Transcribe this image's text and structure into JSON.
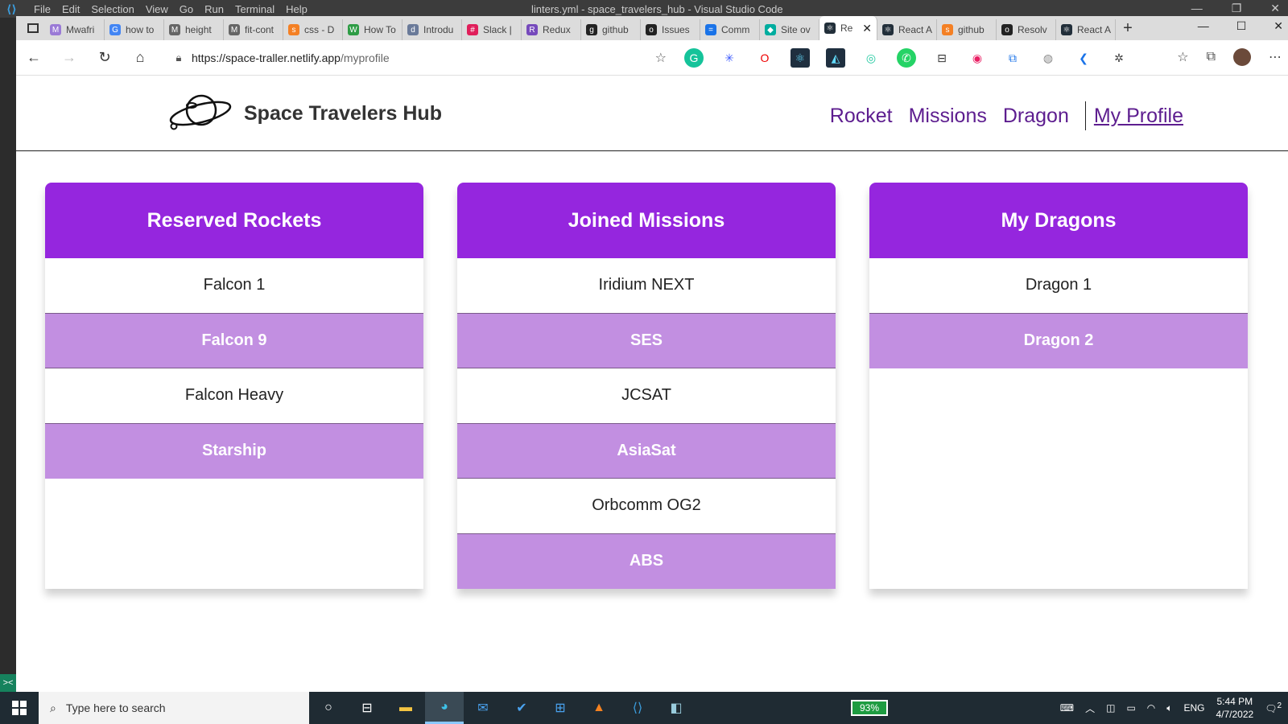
{
  "vscode": {
    "menu": [
      "File",
      "Edit",
      "Selection",
      "View",
      "Go",
      "Run",
      "Terminal",
      "Help"
    ],
    "title": "linters.yml - space_travelers_hub - Visual Studio Code",
    "remote": "><"
  },
  "browser": {
    "tabs": [
      {
        "label": "Mwafri",
        "color": "#9a7ad6",
        "icon": "M"
      },
      {
        "label": "how to",
        "color": "#4285f4",
        "icon": "G"
      },
      {
        "label": "height",
        "color": "#666666",
        "icon": "M"
      },
      {
        "label": "fit-cont",
        "color": "#666666",
        "icon": "M"
      },
      {
        "label": "css - D",
        "color": "#f48024",
        "icon": "s"
      },
      {
        "label": "How To",
        "color": "#2e9c45",
        "icon": "W"
      },
      {
        "label": "Introdu",
        "color": "#6a7a99",
        "icon": "d"
      },
      {
        "label": "Slack |",
        "color": "#e01e5a",
        "icon": "#"
      },
      {
        "label": "Redux",
        "color": "#764abc",
        "icon": "R"
      },
      {
        "label": "github",
        "color": "#222222",
        "icon": "g"
      },
      {
        "label": "Issues",
        "color": "#222222",
        "icon": "o"
      },
      {
        "label": "Comm",
        "color": "#1a73e8",
        "icon": "="
      },
      {
        "label": "Site ov",
        "color": "#00ad9f",
        "icon": "◆"
      },
      {
        "label": "Re",
        "color": "#222f3a",
        "icon": "⚛",
        "active": true
      },
      {
        "label": "React A",
        "color": "#222f3a",
        "icon": "⚛"
      },
      {
        "label": "github",
        "color": "#f48024",
        "icon": "s"
      },
      {
        "label": "Resolv",
        "color": "#222222",
        "icon": "o"
      },
      {
        "label": "React A",
        "color": "#222f3a",
        "icon": "⚛"
      }
    ],
    "url_host": "https://space-traller.netlify.app",
    "url_path": "/myprofile"
  },
  "site": {
    "title": "Space Travelers Hub",
    "nav": {
      "rocket": "Rocket",
      "missions": "Missions",
      "dragon": "Dragon",
      "profile": "My Profile"
    },
    "columns": [
      {
        "heading": "Reserved Rockets",
        "items": [
          "Falcon 1",
          "Falcon 9",
          "Falcon Heavy",
          "Starship"
        ]
      },
      {
        "heading": "Joined Missions",
        "items": [
          "Iridium NEXT",
          "SES",
          "JCSAT",
          "AsiaSat",
          "Orbcomm OG2",
          "ABS"
        ]
      },
      {
        "heading": "My Dragons",
        "items": [
          "Dragon 1",
          "Dragon 2"
        ]
      }
    ],
    "colors": {
      "header": "#9526de",
      "alt_row": "#c28fe1",
      "nav_link": "#5d1d8f"
    }
  },
  "taskbar": {
    "search_placeholder": "Type here to search",
    "battery": "93%",
    "language": "ENG",
    "time": "5:44 PM",
    "date": "4/7/2022",
    "notifications": "2"
  }
}
